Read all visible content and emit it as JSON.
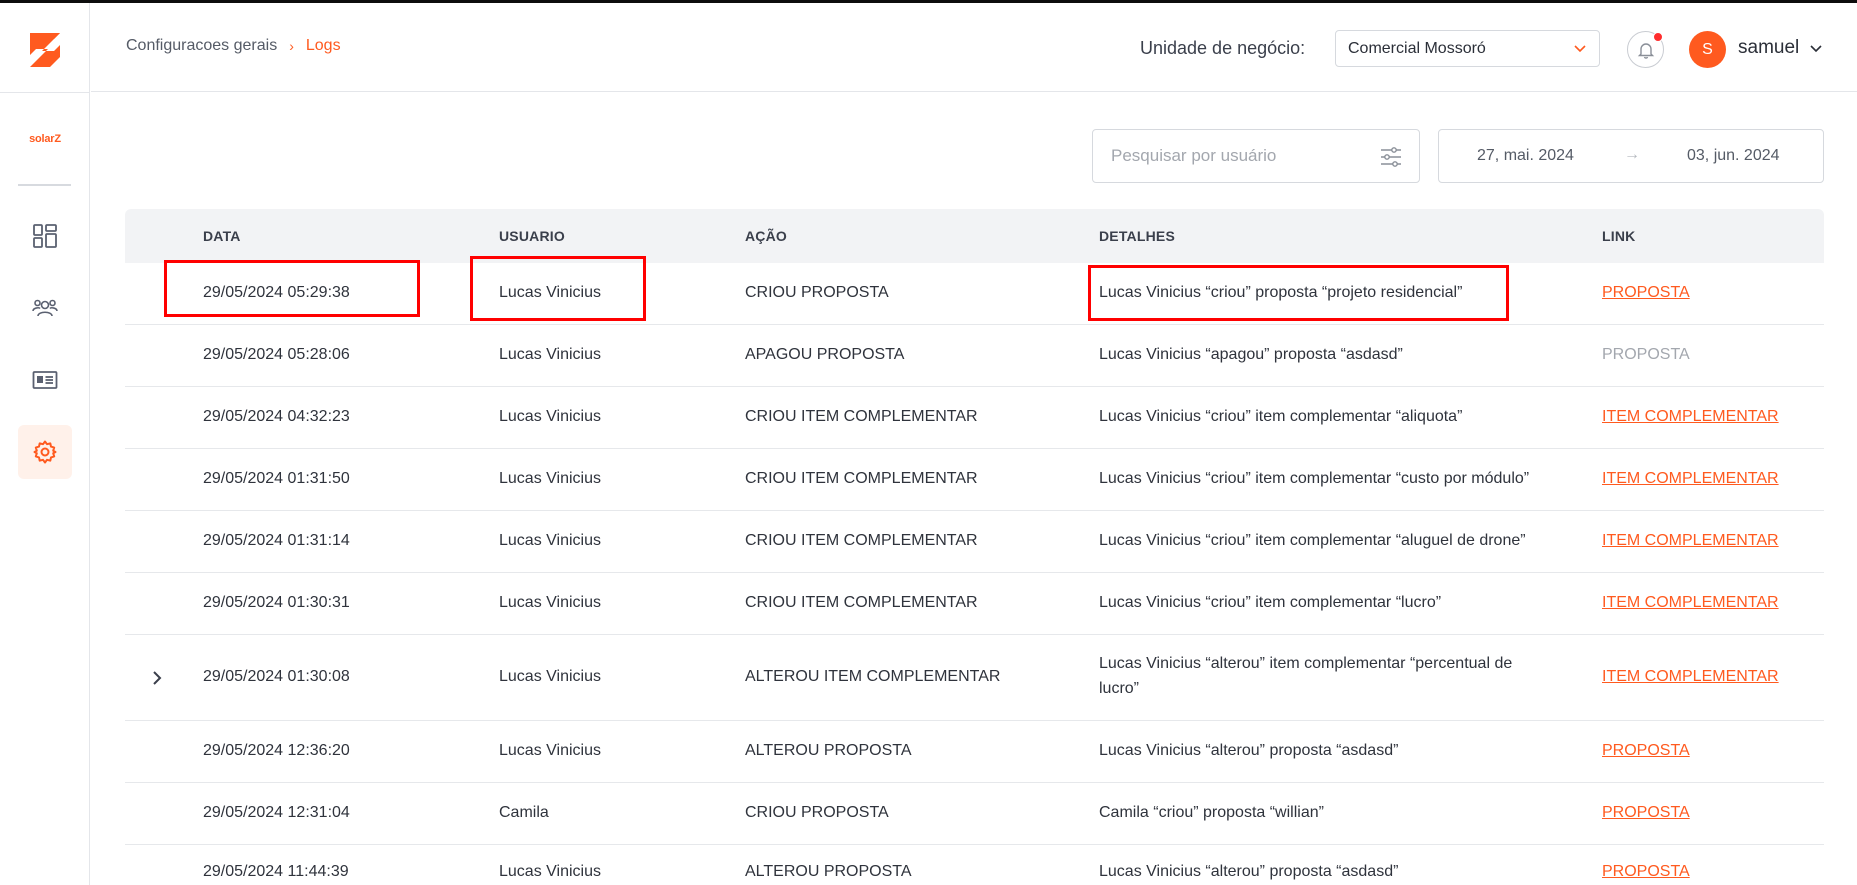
{
  "sidebar": {
    "brand": "solarZ",
    "items": [
      {
        "name": "dashboard",
        "icon": "dashboard-icon"
      },
      {
        "name": "users",
        "icon": "users-icon"
      },
      {
        "name": "proposals",
        "icon": "newspaper-icon"
      },
      {
        "name": "settings",
        "icon": "gear-icon",
        "active": true
      }
    ]
  },
  "header": {
    "breadcrumb": [
      "Configuracoes gerais",
      "Logs"
    ],
    "business_unit_label": "Unidade de negócio:",
    "business_unit_value": "Comercial Mossoró",
    "user_initial": "S",
    "user_name": "samuel"
  },
  "filters": {
    "search_placeholder": "Pesquisar por usuário",
    "date_start": "27, mai. 2024",
    "date_arrow": "→",
    "date_end": "03, jun. 2024"
  },
  "table": {
    "columns": [
      "DATA",
      "USUARIO",
      "AÇÃO",
      "DETALHES",
      "LINK"
    ],
    "rows": [
      {
        "data": "29/05/2024 05:29:38",
        "usuario": "Lucas Vinicius",
        "acao": "CRIOU PROPOSTA",
        "detalhes": "Lucas Vinicius “criou” proposta “projeto residencial”",
        "link": "PROPOSTA",
        "link_enabled": true
      },
      {
        "data": "29/05/2024 05:28:06",
        "usuario": "Lucas Vinicius",
        "acao": "APAGOU PROPOSTA",
        "detalhes": "Lucas Vinicius “apagou” proposta “asdasd”",
        "link": "PROPOSTA",
        "link_enabled": false
      },
      {
        "data": "29/05/2024 04:32:23",
        "usuario": "Lucas Vinicius",
        "acao": "CRIOU ITEM COMPLEMENTAR",
        "detalhes": "Lucas Vinicius “criou” item complementar “aliquota”",
        "link": "ITEM COMPLEMENTAR",
        "link_enabled": true
      },
      {
        "data": "29/05/2024 01:31:50",
        "usuario": "Lucas Vinicius",
        "acao": "CRIOU ITEM COMPLEMENTAR",
        "detalhes": "Lucas Vinicius “criou” item complementar “custo por módulo”",
        "link": "ITEM COMPLEMENTAR",
        "link_enabled": true
      },
      {
        "data": "29/05/2024 01:31:14",
        "usuario": "Lucas Vinicius",
        "acao": "CRIOU ITEM COMPLEMENTAR",
        "detalhes": "Lucas Vinicius “criou” item complementar “aluguel de drone”",
        "link": "ITEM COMPLEMENTAR",
        "link_enabled": true
      },
      {
        "data": "29/05/2024 01:30:31",
        "usuario": "Lucas Vinicius",
        "acao": "CRIOU ITEM COMPLEMENTAR",
        "detalhes": "Lucas Vinicius “criou” item complementar “lucro”",
        "link": "ITEM COMPLEMENTAR",
        "link_enabled": true
      },
      {
        "data": "29/05/2024 01:30:08",
        "usuario": "Lucas Vinicius",
        "acao": "ALTEROU ITEM COMPLEMENTAR",
        "detalhes_line1": "Lucas Vinicius “alterou” item complementar “percentual de",
        "detalhes_line2": "lucro”",
        "link": "ITEM COMPLEMENTAR",
        "link_enabled": true,
        "expandable": true
      },
      {
        "data": "29/05/2024 12:36:20",
        "usuario": "Lucas Vinicius",
        "acao": "ALTEROU PROPOSTA",
        "detalhes": "Lucas Vinicius “alterou” proposta “asdasd”",
        "link": "PROPOSTA",
        "link_enabled": true
      },
      {
        "data": "29/05/2024 12:31:04",
        "usuario": "Camila",
        "acao": "CRIOU PROPOSTA",
        "detalhes": "Camila “criou” proposta “willian”",
        "link": "PROPOSTA",
        "link_enabled": true
      },
      {
        "data": "29/05/2024 11:44:39",
        "usuario": "Lucas Vinicius",
        "acao": "ALTEROU PROPOSTA",
        "detalhes": "Lucas Vinicius “alterou” proposta “asdasd”",
        "link": "PROPOSTA",
        "link_enabled": true
      }
    ]
  },
  "colors": {
    "accent": "#ff5a1f",
    "highlight": "#ff0000"
  }
}
